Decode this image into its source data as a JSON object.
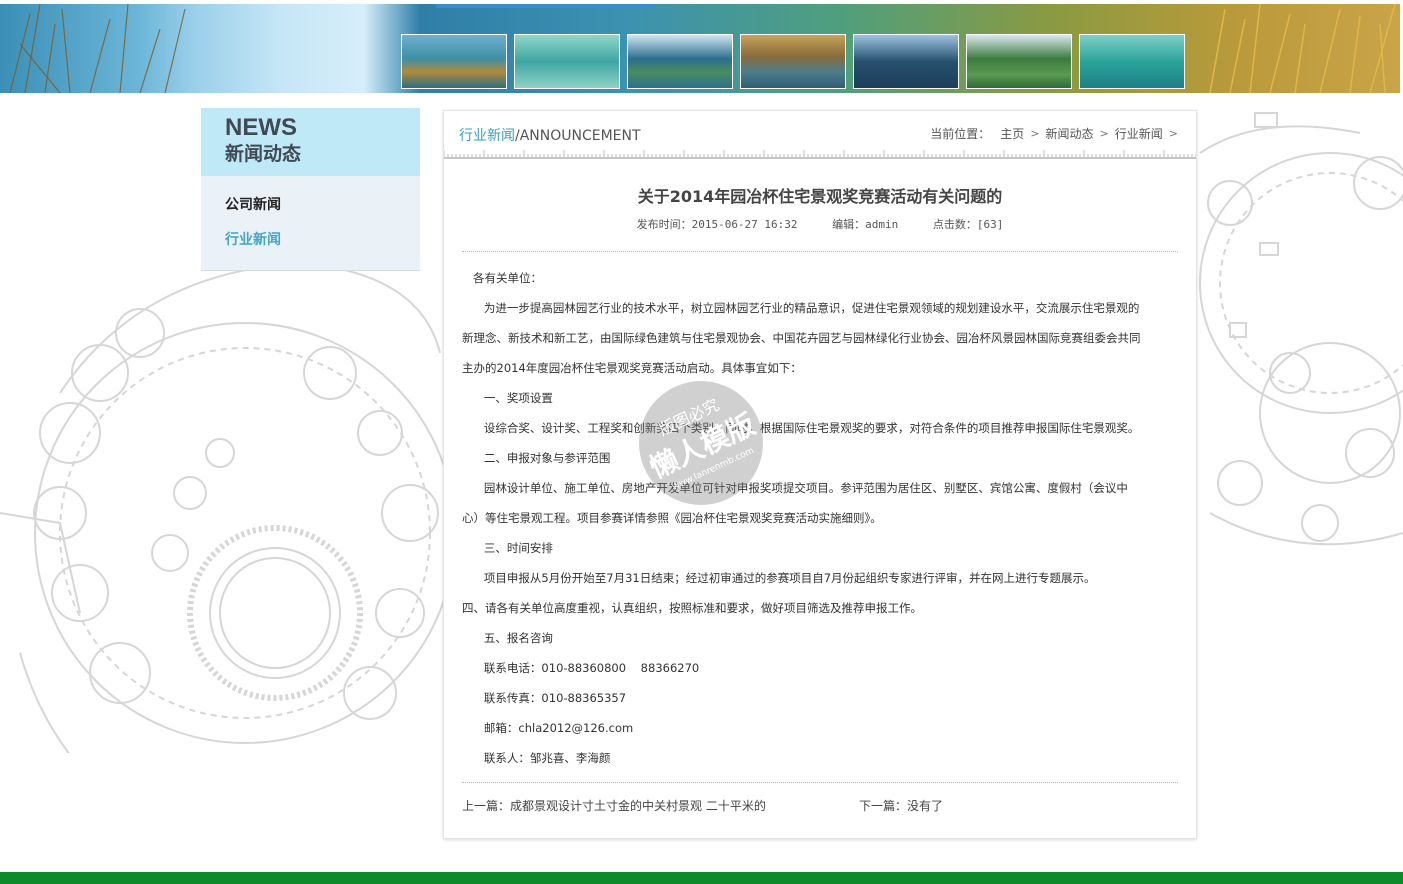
{
  "banner": {
    "thumbnail_count": 7,
    "colors": [
      "#3f8fa4",
      "#3fa6a3",
      "#2c6f8e",
      "#8a6b3a",
      "#27506f",
      "#3c7b3f",
      "#2aa59a"
    ]
  },
  "sidebar": {
    "title_en": "NEWS",
    "title_cn": "新闻动态",
    "items": [
      {
        "label": "公司新闻",
        "active": false
      },
      {
        "label": "行业新闻",
        "active": true
      }
    ]
  },
  "section": {
    "title_cn": "行业新闻",
    "title_en": "/ANNOUNCEMENT"
  },
  "breadcrumb": {
    "label": "当前位置：",
    "items": [
      "主页",
      "新闻动态",
      "行业新闻"
    ]
  },
  "article": {
    "title": "关于2014年园冶杯住宅景观奖竞赛活动有关问题的",
    "publish_time": "发布时间：2015-06-27 16:32",
    "editor": "编辑：admin",
    "clicks": "点击数：[63]",
    "paragraphs": [
      "   各有关单位：",
      "      为进一步提高园林园艺行业的技术水平，树立园林园艺行业的精品意识，促进住宅景观领域的规划建设水平，交流展示住宅景观的",
      "新理念、新技术和新工艺，由国际绿色建筑与住宅景观协会、中国花卉园艺与园林绿化行业协会、园冶杯风景园林国际竞赛组委会共同",
      "主办的2014年度园冶杯住宅景观奖竞赛活动启动。具体事宜如下：",
      "      一、奖项设置",
      "      设综合奖、设计奖、工程奖和创新奖四个类别。同时，根据国际住宅景观奖的要求，对符合条件的项目推荐申报国际住宅景观奖。",
      "      二、申报对象与参评范围",
      "      园林设计单位、施工单位、房地产开发单位可针对申报奖项提交项目。参评范围为居住区、别墅区、宾馆公寓、度假村（会议中",
      "心）等住宅景观工程。项目参赛详情参照《园冶杯住宅景观奖竞赛活动实施细则》。",
      "      三、时间安排",
      "      项目申报从5月份开始至7月31日结束；经过初审通过的参赛项目自7月份起组织专家进行评审，并在网上进行专题展示。",
      "四、请各有关单位高度重视，认真组织，按照标准和要求，做好项目筛选及推荐申报工作。",
      "      五、报名咨询",
      "      联系电话：010-88360800    88366270",
      "      联系传真：010-88365357",
      "      邮箱：chla2012@126.com",
      "      联系人：邹兆喜、李海颜"
    ]
  },
  "pager": {
    "prev": "上一篇：成都景观设计寸土寸金的中关村景观 二十平米的",
    "next": "下一篇：没有了"
  },
  "watermark": {
    "line1": "版图必究",
    "line2": "懒人模版",
    "line3": "www.lanrenmb.com"
  },
  "colors": {
    "accent": "#47a5c4",
    "sidebar_head": "#bfe9f7",
    "footer": "#0e8a2b"
  }
}
